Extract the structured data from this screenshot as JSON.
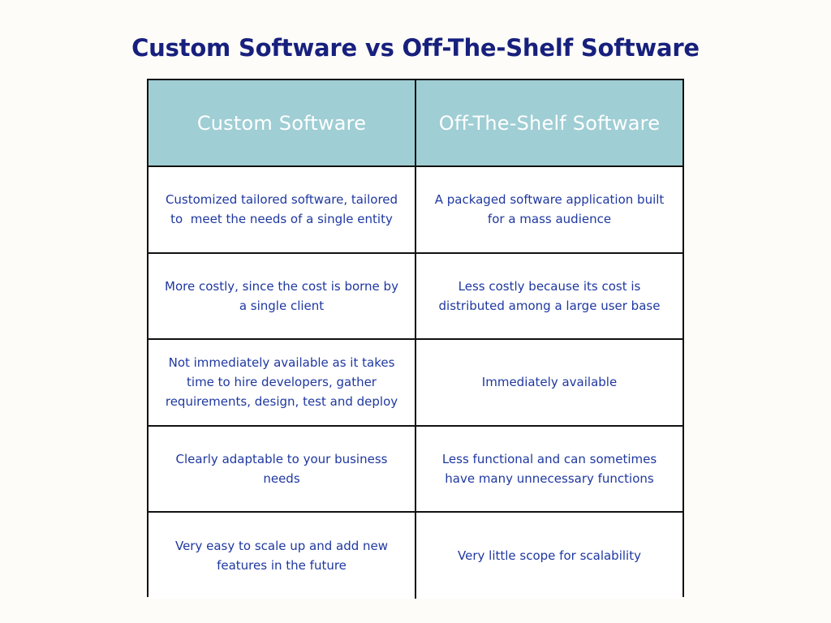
{
  "slide": {
    "title": "Custom Software vs Off-The-Shelf Software",
    "background_color": "#fdfcf8",
    "title_color": "#17207d"
  },
  "table": {
    "header_background_color": "#9fced4",
    "header_text_color": "#ffffff",
    "body_text_color": "#1f38a0",
    "border_color": "#111111",
    "columns": [
      {
        "label": "Custom Software"
      },
      {
        "label": "Off-The-Shelf Software"
      }
    ],
    "rows": [
      {
        "custom": "Customized tailored software, tailored to  meet the needs of a single entity",
        "offtheshelf": "A packaged software application built for a mass audience"
      },
      {
        "custom": "More costly, since the cost is borne by a single client",
        "offtheshelf": "Less costly because its cost is distributed among a large user base"
      },
      {
        "custom": "Not immediately available as it takes time to hire developers, gather requirements, design, test and deploy",
        "offtheshelf": "Immediately available"
      },
      {
        "custom": "Clearly adaptable to your business needs",
        "offtheshelf": "Less functional and can sometimes have many unnecessary functions"
      },
      {
        "custom": "Very easy to scale up and add new features in the future",
        "offtheshelf": "Very little scope for scalability"
      }
    ]
  }
}
